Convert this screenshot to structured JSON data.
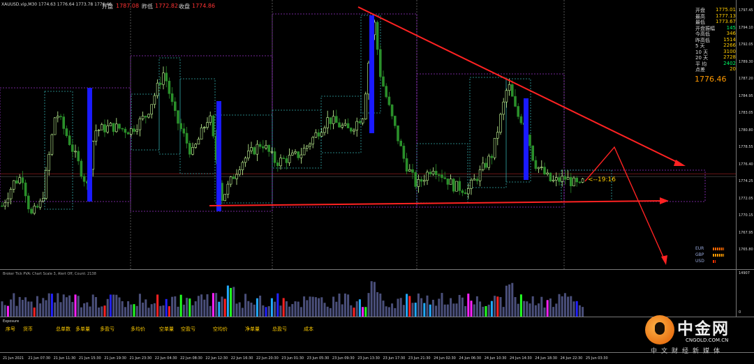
{
  "header": {
    "symbol_info": "XAUUSD.vip,M30  1774.63 1776.64 1773.78 1776.46",
    "open_label": "开盘",
    "open_value": "1787.08",
    "low_label": "昨低",
    "low_value": "1772.82",
    "close_label": "收盘",
    "close_value": "1774.86"
  },
  "stats_panel": [
    {
      "key": "开盘",
      "value": "1775.01",
      "color": "#ffcc00"
    },
    {
      "key": "最高",
      "value": "1777.13",
      "color": "#ffcc00"
    },
    {
      "key": "最低",
      "value": "1773.67",
      "color": "#ffcc00"
    },
    {
      "key": "开盘振幅",
      "value": "145",
      "color": "#00ff66"
    },
    {
      "key": "今高低",
      "value": "346",
      "color": "#ffcc00"
    },
    {
      "key": "昨高低",
      "value": "1514",
      "color": "#ffcc00"
    },
    {
      "key": "5  天",
      "value": "2266",
      "color": "#ffcc00"
    },
    {
      "key": "10  天",
      "value": "3100",
      "color": "#ffcc00"
    },
    {
      "key": "20  天",
      "value": "2728",
      "color": "#ffcc00"
    },
    {
      "key": "平  均",
      "value": "2402",
      "color": "#00ff66"
    },
    {
      "key": "点差",
      "value": "20",
      "color": "#ffcc00"
    }
  ],
  "big_price": "1776.46",
  "countdown": "<--19:16",
  "currencies": [
    {
      "name": "EUR",
      "color": "#ff6600"
    },
    {
      "name": "GBP",
      "color": "#ff9900"
    },
    {
      "name": "USD",
      "color": "#ff3300"
    }
  ],
  "price_axis": [
    "1797.45",
    "1794.10",
    "1792.05",
    "1789.30",
    "1787.20",
    "1784.95",
    "1783.05",
    "1780.80",
    "1778.55",
    "1776.40",
    "1774.25",
    "1772.05",
    "1770.15",
    "1767.95",
    "1765.80"
  ],
  "volume_axis": {
    "top": "14907",
    "bottom": "0"
  },
  "volume_header": "Broker Tick PVA:  Chart Scale 3, Alert Off,  Count: 2138",
  "exposure": {
    "title": "Exposure",
    "columns": [
      "序号",
      "货币",
      "总单数",
      "多单量",
      "多盈亏",
      "多均价",
      "空单量",
      "空盈亏",
      "空均价",
      "净单量",
      "总盈亏",
      "成本"
    ]
  },
  "time_axis": [
    "21 Jun 2021",
    "21 Jun 07:30",
    "21 Jun 11:30",
    "21 Jun 15:30",
    "21 Jun 19:30",
    "21 Jun 23:30",
    "22 Jun 04:30",
    "22 Jun 08:30",
    "22 Jun 12:30",
    "22 Jun 16:30",
    "22 Jun 20:30",
    "23 Jun 01:30",
    "23 Jun 05:30",
    "23 Jun 09:30",
    "23 Jun 13:30",
    "23 Jun 17:30",
    "23 Jun 21:30",
    "24 Jun 02:30",
    "24 Jun 06:30",
    "24 Jun 10:30",
    "24 Jun 14:30",
    "24 Jun 18:30",
    "24 Jun 22:30",
    "25 Jun 03:30"
  ],
  "logo": {
    "name": "中金网",
    "url": "CNGOLD.COM.CN",
    "slogan": "中文财经新媒体"
  },
  "colors": {
    "bull": "#c8ff9a",
    "bear": "#2a8f2a",
    "trend": "#ff2222",
    "volume": "#4a4f7a"
  }
}
